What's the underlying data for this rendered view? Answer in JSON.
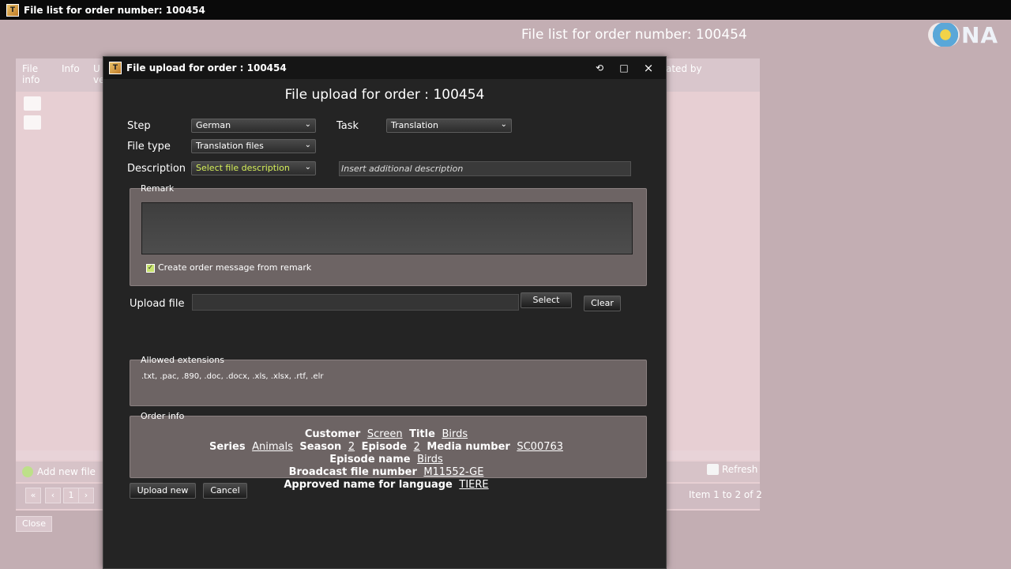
{
  "outer_window": {
    "title": "File list for order number: 100454",
    "header_title": "File list for order number: 100454",
    "logo_text": "NA",
    "table_headers": [
      "File info",
      "Info",
      "U ve",
      "ated by"
    ],
    "add_new_file": "Add new file",
    "refresh": "Refresh",
    "page_buttons": [
      "«",
      "‹",
      "1",
      "›"
    ],
    "current_page": "1",
    "items_count": "Item 1 to 2 of 2",
    "close": "Close"
  },
  "dialog": {
    "title": "File upload for order : 100454",
    "heading": "File upload for order : 100454",
    "controls": {
      "restore": "⟲",
      "maximize": "□",
      "close": "×"
    },
    "step_label": "Step",
    "step_value": "German",
    "task_label": "Task",
    "task_value": "Translation",
    "file_type_label": "File type",
    "file_type_value": "Translation files",
    "description_label": "Description",
    "description_value": "Select file description",
    "additional_description_placeholder": "Insert additional description",
    "remark_title": "Remark",
    "remark_value": "",
    "create_message_label": "Create order message from remark",
    "create_message_checked": true,
    "upload_file_label": "Upload file",
    "upload_file_value": "",
    "select_button": "Select",
    "clear_button": "Clear",
    "allowed_ext_title": "Allowed extensions",
    "allowed_extensions": ".txt, .pac, .890, .doc, .docx, .xls, .xlsx, .rtf, .elr",
    "order_info_title": "Order info",
    "order_info": {
      "customer_label": "Customer",
      "customer_value": "Screen",
      "title_label": "Title",
      "title_value": "Birds",
      "series_label": "Series",
      "series_value": "Animals",
      "season_label": "Season",
      "season_value": "2",
      "episode_label": "Episode",
      "episode_value": "2",
      "media_number_label": "Media number",
      "media_number_value": "SC00763",
      "episode_name_label": "Episode name",
      "episode_name_value": "Birds",
      "broadcast_label": "Broadcast file number",
      "broadcast_value": "M11552-GE",
      "approved_label": "Approved name for language",
      "approved_value": "TIERE"
    },
    "upload_new_button": "Upload new",
    "cancel_button": "Cancel"
  },
  "colors": {
    "background": "#c3aeb3",
    "dialog_bg": "#242424",
    "group_bg": "#6d6464",
    "accent_text": "#d6f05a"
  }
}
